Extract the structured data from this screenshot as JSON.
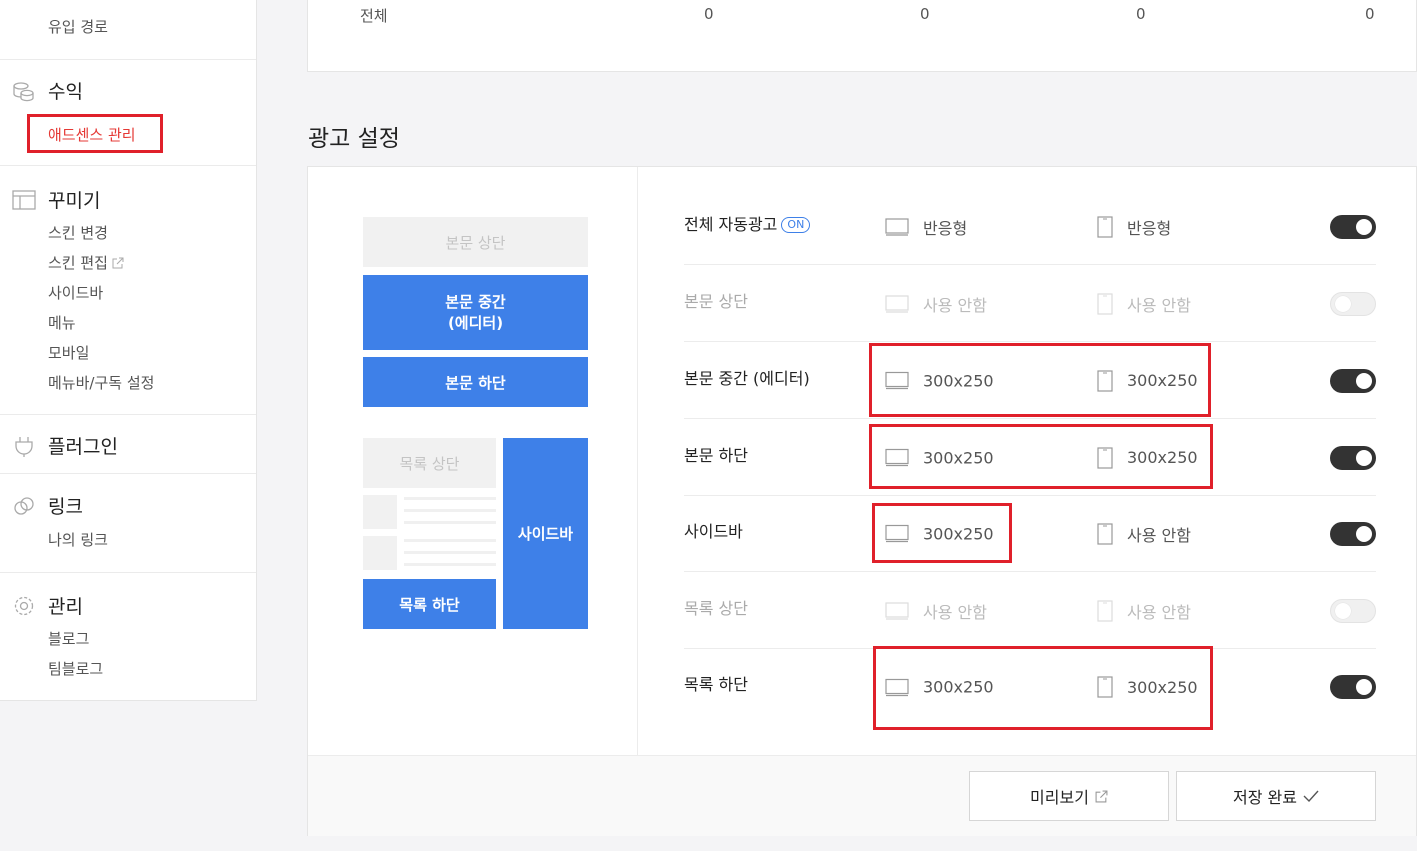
{
  "sidebar": {
    "top_items": [
      "유입 경로"
    ],
    "revenue": {
      "title": "수익",
      "items": [
        "애드센스 관리"
      ]
    },
    "decorate": {
      "title": "꾸미기",
      "items": [
        "스킨 변경",
        "스킨 편집",
        "사이드바",
        "메뉴",
        "모바일",
        "메뉴바/구독 설정"
      ]
    },
    "plugin": {
      "title": "플러그인"
    },
    "link": {
      "title": "링크",
      "items": [
        "나의 링크"
      ]
    },
    "manage": {
      "title": "관리",
      "items": [
        "블로그",
        "팀블로그"
      ]
    }
  },
  "stats": {
    "label": "전체",
    "values": [
      "0",
      "0",
      "0",
      "0"
    ]
  },
  "ad_settings": {
    "title": "광고 설정",
    "preview": {
      "body_top": "본문 상단",
      "body_middle": "본문 중간\n(에디터)",
      "body_bottom": "본문 하단",
      "list_top": "목록 상단",
      "sidebar": "사이드바",
      "list_bottom": "목록 하단"
    },
    "rows": [
      {
        "label": "전체 자동광고",
        "badge": "ON",
        "pc": "반응형",
        "mobile": "반응형",
        "enabled": true
      },
      {
        "label": "본문 상단",
        "pc": "사용 안함",
        "mobile": "사용 안함",
        "enabled": false
      },
      {
        "label": "본문 중간 (에디터)",
        "pc": "300x250",
        "mobile": "300x250",
        "enabled": true
      },
      {
        "label": "본문 하단",
        "pc": "300x250",
        "mobile": "300x250",
        "enabled": true
      },
      {
        "label": "사이드바",
        "pc": "300x250",
        "mobile": "사용 안함",
        "enabled": true
      },
      {
        "label": "목록 상단",
        "pc": "사용 안함",
        "mobile": "사용 안함",
        "enabled": false
      },
      {
        "label": "목록 하단",
        "pc": "300x250",
        "mobile": "300x250",
        "enabled": true
      }
    ],
    "buttons": {
      "preview": "미리보기",
      "save": "저장 완료"
    }
  },
  "colors": {
    "accent": "#3e80e8",
    "highlight": "#e0202a",
    "active_menu": "#e53935"
  }
}
